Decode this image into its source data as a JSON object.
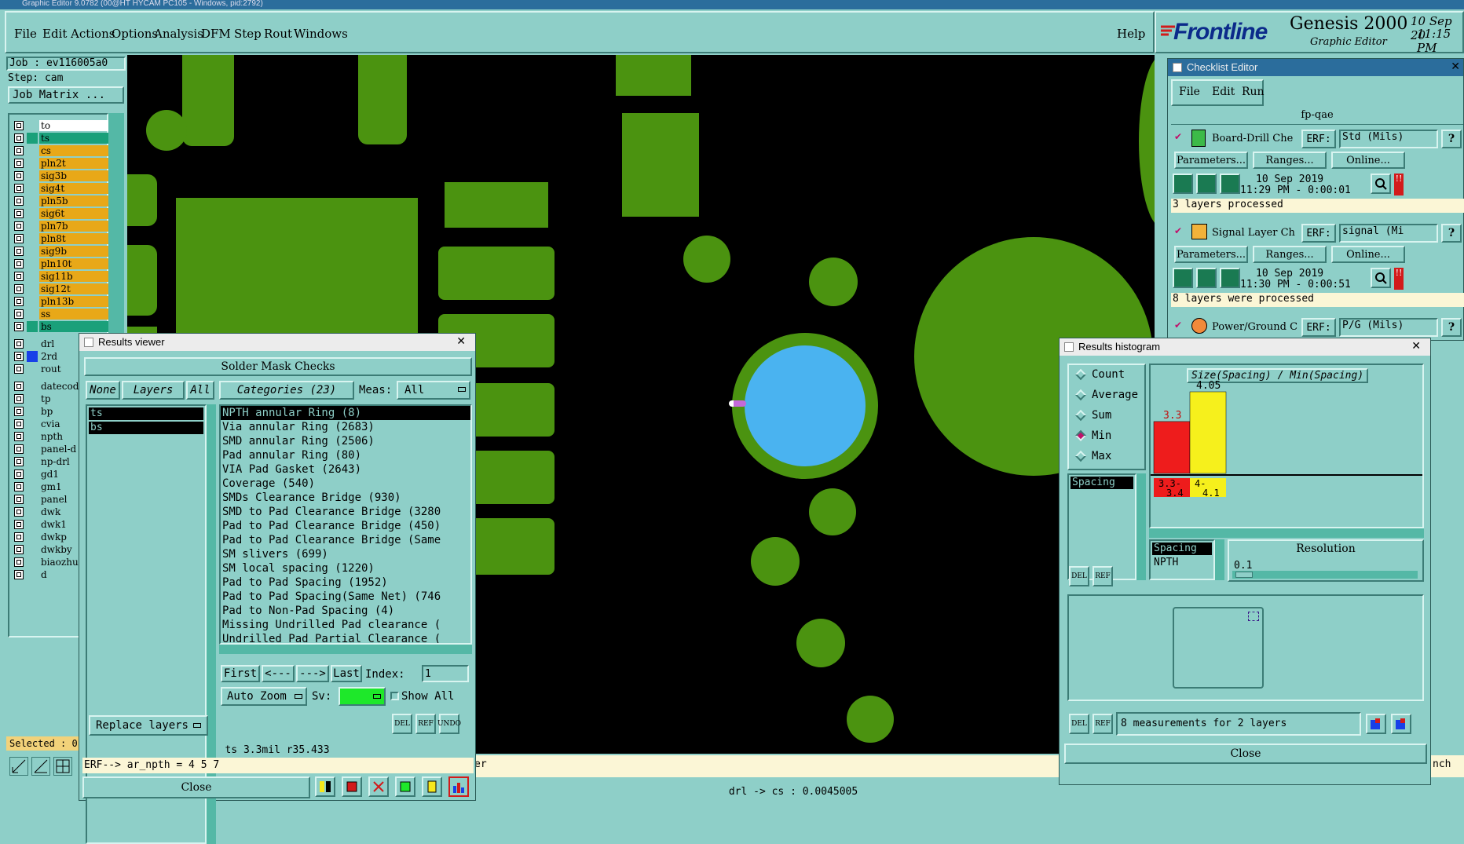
{
  "os_title": "Graphic Editor 9.0782 (00@HT HYCAM PC105 - Windows, pid:2792)",
  "menubar": {
    "items": [
      "File",
      "Edit",
      "Actions",
      "Options",
      "Analysis",
      "DFM",
      "Step",
      "Rout",
      "Windows"
    ],
    "help": "Help"
  },
  "brand": {
    "logo": "Frontline",
    "product": "Genesis 2000",
    "subtitle": "Graphic Editor",
    "date": "10 Sep 20",
    "time": "11:15 PM"
  },
  "job": {
    "job_label": "Job : ev116005a0",
    "step_label": "Step: cam",
    "matrix_button": "Job Matrix ..."
  },
  "layers": [
    {
      "name": "to",
      "color": "#ffffff",
      "chip": "#8ecfc8"
    },
    {
      "name": "ts",
      "color": "#1aa07a",
      "chip": "#1aa07a",
      "selected": true
    },
    {
      "name": "cs",
      "color": "#e8a818",
      "chip": "#8ecfc8"
    },
    {
      "name": "pln2t",
      "color": "#e8a818",
      "chip": "#8ecfc8"
    },
    {
      "name": "sig3b",
      "color": "#e8a818",
      "chip": "#8ecfc8"
    },
    {
      "name": "sig4t",
      "color": "#e8a818",
      "chip": "#8ecfc8"
    },
    {
      "name": "pln5b",
      "color": "#e8a818",
      "chip": "#8ecfc8"
    },
    {
      "name": "sig6t",
      "color": "#e8a818",
      "chip": "#8ecfc8"
    },
    {
      "name": "pln7b",
      "color": "#e8a818",
      "chip": "#8ecfc8"
    },
    {
      "name": "pln8t",
      "color": "#e8a818",
      "chip": "#8ecfc8"
    },
    {
      "name": "sig9b",
      "color": "#e8a818",
      "chip": "#8ecfc8"
    },
    {
      "name": "pln10t",
      "color": "#e8a818",
      "chip": "#8ecfc8"
    },
    {
      "name": "sig11b",
      "color": "#e8a818",
      "chip": "#8ecfc8"
    },
    {
      "name": "sig12t",
      "color": "#e8a818",
      "chip": "#8ecfc8"
    },
    {
      "name": "pln13b",
      "color": "#e8a818",
      "chip": "#8ecfc8"
    },
    {
      "name": "ss",
      "color": "#e8a818",
      "chip": "#8ecfc8"
    },
    {
      "name": "bs",
      "color": "#1aa07a",
      "chip": "#1aa07a"
    },
    {
      "name": "drl",
      "color": "#8ecfc8",
      "chip": "#8ecfc8"
    },
    {
      "name": "2rd",
      "color": "#8ecfc8",
      "chip": "#1840e8"
    },
    {
      "name": "rout",
      "color": "#8ecfc8",
      "chip": "#8ecfc8"
    },
    {
      "name": "datecod",
      "color": "#8ecfc8",
      "chip": "#8ecfc8"
    },
    {
      "name": "tp",
      "color": "#8ecfc8",
      "chip": "#8ecfc8"
    },
    {
      "name": "bp",
      "color": "#8ecfc8",
      "chip": "#8ecfc8"
    },
    {
      "name": "cvia",
      "color": "#8ecfc8",
      "chip": "#8ecfc8"
    },
    {
      "name": "npth",
      "color": "#8ecfc8",
      "chip": "#8ecfc8"
    },
    {
      "name": "panel-d",
      "color": "#8ecfc8",
      "chip": "#8ecfc8"
    },
    {
      "name": "np-drl",
      "color": "#8ecfc8",
      "chip": "#8ecfc8"
    },
    {
      "name": "gd1",
      "color": "#8ecfc8",
      "chip": "#8ecfc8"
    },
    {
      "name": "gm1",
      "color": "#8ecfc8",
      "chip": "#8ecfc8"
    },
    {
      "name": "panel",
      "color": "#8ecfc8",
      "chip": "#8ecfc8"
    },
    {
      "name": "dwk",
      "color": "#8ecfc8",
      "chip": "#8ecfc8"
    },
    {
      "name": "dwk1",
      "color": "#8ecfc8",
      "chip": "#8ecfc8"
    },
    {
      "name": "dwkp",
      "color": "#8ecfc8",
      "chip": "#8ecfc8"
    },
    {
      "name": "dwkby",
      "color": "#8ecfc8",
      "chip": "#8ecfc8"
    },
    {
      "name": "biaozhu",
      "color": "#8ecfc8",
      "chip": "#8ecfc8"
    },
    {
      "name": "d",
      "color": "#8ecfc8",
      "chip": "#8ecfc8"
    }
  ],
  "selected_label": "Selected : 0",
  "status_bar": "drl -> cs : 0.0045005",
  "results_viewer": {
    "title": "Results viewer",
    "heading": "Solder Mask Checks",
    "none_btn": "None",
    "layers_btn": "Layers",
    "all_btn": "All",
    "categories_btn": "Categories (23)",
    "meas_label": "Meas:",
    "meas_value": "All",
    "layer_items": [
      "ts",
      "bs"
    ],
    "categories": [
      "NPTH annular Ring (8)",
      "Via annular Ring (2683)",
      "SMD annular Ring (2506)",
      "Pad annular Ring (80)",
      "VIA Pad Gasket (2643)",
      "Coverage (540)",
      "SMDs Clearance Bridge (930)",
      "SMD to Pad Clearance Bridge (3280",
      "Pad to Pad Clearance Bridge (450)",
      "Pad to Pad Clearance Bridge (Same",
      "SM slivers (699)",
      "SM local spacing (1220)",
      "Pad to Pad Spacing (1952)",
      "Pad to Pad Spacing(Same Net) (746",
      "Pad to Non-Pad Spacing (4)",
      "Missing Undrilled Pad clearance (",
      "Undrilled Pad Partial Clearance ("
    ],
    "first_btn": "First",
    "prev_btn": "<---",
    "next_btn": "--->",
    "last_btn": "Last",
    "index_label": "Index:",
    "index_value": "1",
    "auto_zoom": "Auto Zoom",
    "sv_label": "Sv:",
    "show_all": "Show All",
    "replace_layers": "Replace layers",
    "del": "DEL",
    "ref": "REF",
    "undo": "UNDO",
    "status": "ts 3.3mil  r35.433",
    "erf_line": "ERF--> ar_npth = 4 5 7",
    "close": "Close"
  },
  "checklist_editor": {
    "title": "Checklist Editor",
    "menu": [
      "File",
      "Edit",
      "Run"
    ],
    "checklist_name": "fp-qae",
    "erf_label": "ERF:",
    "parameters_btn": "Parameters...",
    "ranges_btn": "Ranges...",
    "online_btn": "Online...",
    "actions": [
      {
        "name": "Board-Drill Che",
        "erf": "Std (Mils)",
        "date": "10 Sep 2019",
        "time": "11:29 PM - 0:00:01",
        "status": "3 layers processed"
      },
      {
        "name": "Signal Layer Ch",
        "erf": "signal (Mi",
        "date": "10 Sep 2019",
        "time": "11:30 PM - 0:00:51",
        "status": "8 layers were processed"
      },
      {
        "name": "Power/Ground C",
        "erf": "P/G (Mils)"
      }
    ]
  },
  "histogram": {
    "title": "Results histogram",
    "modes": [
      "Count",
      "Average",
      "Sum",
      "Min",
      "Max"
    ],
    "selected_mode": "Min",
    "list_item": "Spacing",
    "chart_title": "Size(Spacing) / Min(Spacing)",
    "bars": [
      {
        "value": "3.3",
        "range": "3.3-3.4",
        "color": "#ee1c1c"
      },
      {
        "value": "4.05",
        "range": "4-4.1",
        "color": "#f6f01c"
      }
    ],
    "legend_items": [
      "Spacing",
      "NPTH"
    ],
    "resolution_label": "Resolution",
    "resolution_value": "0.1",
    "measurements": "8 measurements for 2 layers",
    "close": "Close",
    "del": "DEL",
    "ref": "REF"
  },
  "canvas_text": {
    "er_fragment": "er",
    "nch_fragment": "nch"
  },
  "chart_data": {
    "type": "bar",
    "title": "Size(Spacing) / Min(Spacing)",
    "categories": [
      "3.3-3.4",
      "4-4.1"
    ],
    "values": [
      3.3,
      4.05
    ],
    "xlabel": "",
    "ylabel": ""
  }
}
